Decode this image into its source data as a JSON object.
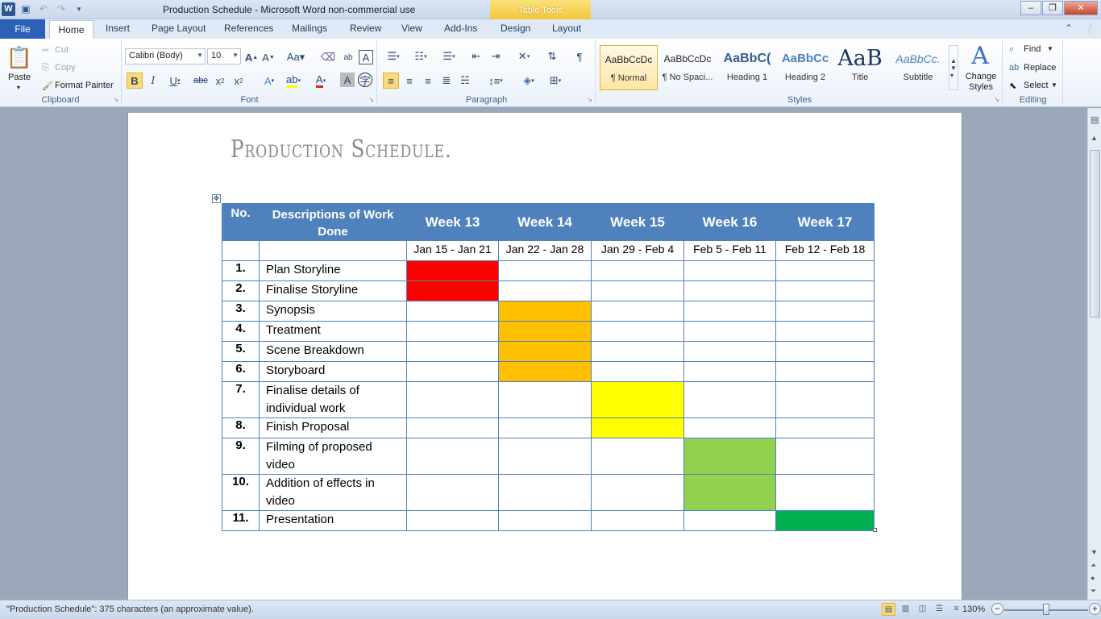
{
  "window": {
    "title": "Production Schedule - Microsoft Word non-commercial use",
    "contextual_tab": "Table Tools",
    "app_icon": "W"
  },
  "tabs": [
    {
      "label": "File"
    },
    {
      "label": "Home"
    },
    {
      "label": "Insert"
    },
    {
      "label": "Page Layout"
    },
    {
      "label": "References"
    },
    {
      "label": "Mailings"
    },
    {
      "label": "Review"
    },
    {
      "label": "View"
    },
    {
      "label": "Add-Ins"
    },
    {
      "label": "Design"
    },
    {
      "label": "Layout"
    }
  ],
  "ribbon": {
    "clipboard": {
      "label": "Clipboard",
      "paste": "Paste",
      "cut": "Cut",
      "copy": "Copy",
      "format_painter": "Format Painter"
    },
    "font": {
      "label": "Font",
      "font_name": "Calibri (Body)",
      "font_size": "10"
    },
    "paragraph": {
      "label": "Paragraph"
    },
    "styles": {
      "label": "Styles",
      "items": [
        {
          "sample": "AaBbCcDc",
          "name": "¶ Normal"
        },
        {
          "sample": "AaBbCcDc",
          "name": "¶ No Spaci..."
        },
        {
          "sample": "AaBbC(",
          "name": "Heading 1"
        },
        {
          "sample": "AaBbCc",
          "name": "Heading 2"
        },
        {
          "sample": "AaB",
          "name": "Title"
        },
        {
          "sample": "AaBbCc.",
          "name": "Subtitle"
        }
      ],
      "change_styles": "Change Styles"
    },
    "editing": {
      "label": "Editing",
      "find": "Find",
      "replace": "Replace",
      "select": "Select"
    }
  },
  "document": {
    "title": "Production Schedule.",
    "table": {
      "header": {
        "no": "No.",
        "desc": "Descriptions of Work Done",
        "weeks": [
          "Week 13",
          "Week 14",
          "Week 15",
          "Week 16",
          "Week 17"
        ]
      },
      "dates": [
        "Jan 15 - Jan 21",
        "Jan 22 - Jan 28",
        "Jan 29 - Feb 4",
        "Feb 5 - Feb 11",
        "Feb 12 - Feb 18"
      ],
      "rows": [
        {
          "no": "1.",
          "desc": "Plan Storyline",
          "week": 0,
          "color": "#ff0000"
        },
        {
          "no": "2.",
          "desc": "Finalise Storyline",
          "week": 0,
          "color": "#ff0000"
        },
        {
          "no": "3.",
          "desc": "Synopsis",
          "week": 1,
          "color": "#ffc000"
        },
        {
          "no": "4.",
          "desc": "Treatment",
          "week": 1,
          "color": "#ffc000"
        },
        {
          "no": "5.",
          "desc": "Scene  Breakdown",
          "week": 1,
          "color": "#ffc000"
        },
        {
          "no": "6.",
          "desc": "Storyboard",
          "week": 1,
          "color": "#ffc000"
        },
        {
          "no": "7.",
          "desc": "Finalise details of individual work",
          "week": 2,
          "color": "#ffff00"
        },
        {
          "no": "8.",
          "desc": "Finish Proposal",
          "week": 2,
          "color": "#ffff00"
        },
        {
          "no": "9.",
          "desc": "Filming of proposed video",
          "week": 3,
          "color": "#92d050"
        },
        {
          "no": "10.",
          "desc": "Addition of effects in video",
          "week": 3,
          "color": "#92d050"
        },
        {
          "no": "11.",
          "desc": "Presentation",
          "week": 4,
          "color": "#00b050"
        }
      ]
    }
  },
  "status": {
    "text": "\"Production Schedule\": 375 characters (an approximate value).",
    "zoom": "130%",
    "zoom_level": 130
  }
}
